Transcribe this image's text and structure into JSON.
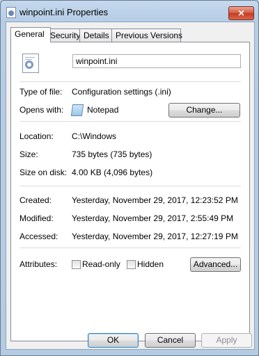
{
  "window": {
    "title": "winpoint.ini Properties",
    "close_label": "✕"
  },
  "tabs": [
    "General",
    "Security",
    "Details",
    "Previous Versions"
  ],
  "general": {
    "file_name": "winpoint.ini",
    "type_label": "Type of file:",
    "type_value": "Configuration settings (.ini)",
    "opens_label": "Opens with:",
    "opens_value": "Notepad",
    "change_label": "Change...",
    "location_label": "Location:",
    "location_value": "C:\\Windows",
    "size_label": "Size:",
    "size_value": "735 bytes (735 bytes)",
    "size_disk_label": "Size on disk:",
    "size_disk_value": "4.00 KB (4,096 bytes)",
    "created_label": "Created:",
    "created_value": "Yesterday, November 29, 2017, 12:23:52 PM",
    "modified_label": "Modified:",
    "modified_value": "Yesterday, November 29, 2017, 2:55:49 PM",
    "accessed_label": "Accessed:",
    "accessed_value": "Yesterday, November 29, 2017, 12:27:19 PM",
    "attributes_label": "Attributes:",
    "readonly_label": "Read-only",
    "readonly_checked": false,
    "hidden_label": "Hidden",
    "hidden_checked": false,
    "advanced_label": "Advanced..."
  },
  "footer": {
    "ok_label": "OK",
    "cancel_label": "Cancel",
    "apply_label": "Apply"
  }
}
